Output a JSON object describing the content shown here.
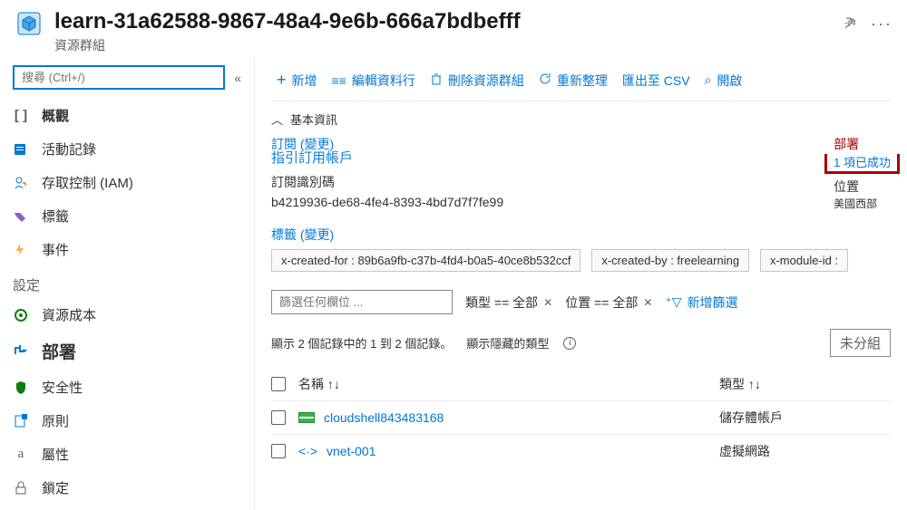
{
  "header": {
    "title": "learn-31a62588-9867-48a4-9e6b-666a7bdbefff",
    "subtitle": "資源群組"
  },
  "search": {
    "placeholder": "搜尋 (Ctrl+/)"
  },
  "sidebar": {
    "items": [
      {
        "label": "概觀"
      },
      {
        "label": "活動記錄"
      },
      {
        "label": "存取控制 (IAM)"
      },
      {
        "label": "標籤"
      },
      {
        "label": "事件"
      }
    ],
    "section_label": "設定",
    "settings": [
      {
        "label": "資源成本"
      },
      {
        "label": "部署"
      },
      {
        "label": "安全性"
      },
      {
        "label": "原則"
      },
      {
        "label": "屬性"
      },
      {
        "label": "鎖定"
      }
    ]
  },
  "toolbar": {
    "add": "新增",
    "edit_cols": "編輯資料行",
    "delete": "刪除資源群組",
    "refresh": "重新整理",
    "export_csv": "匯出至 CSV",
    "open": "開啟"
  },
  "essentials": {
    "toggle": "基本資訊",
    "subscription_label": "訂閱 (變更)",
    "subscription_link": "指引訂用帳戶",
    "subscription_id_label": "訂閱識別碼",
    "subscription_id": "b4219936-de68-4fe4-8393-4bd7d7f7fe99",
    "deployments_label": "部署",
    "deployments_value": "1 項已成功",
    "location_label": "位置",
    "location_value": "美國西部"
  },
  "tags": {
    "label": "標籤 (變更)",
    "list": [
      "x-created-for : 89b6a9fb-c37b-4fd4-b0a5-40ce8b532ccf",
      "x-created-by : freelearning",
      "x-module-id :"
    ]
  },
  "filters": {
    "placeholder": "篩選任何欄位 ...",
    "type": "類型 == 全部",
    "location": "位置 == 全部",
    "add": "新增篩選"
  },
  "records": {
    "summary": "顯示 2 個記錄中的 1 到 2 個記錄。",
    "hidden": "顯示隱藏的類型",
    "group": "未分組"
  },
  "table": {
    "col_name": "名稱 ↑↓",
    "col_type": "類型 ↑↓",
    "rows": [
      {
        "name": "cloudshell843483168",
        "type": "儲存體帳戶"
      },
      {
        "name": "vnet-001",
        "type": "虛擬網路"
      }
    ]
  }
}
